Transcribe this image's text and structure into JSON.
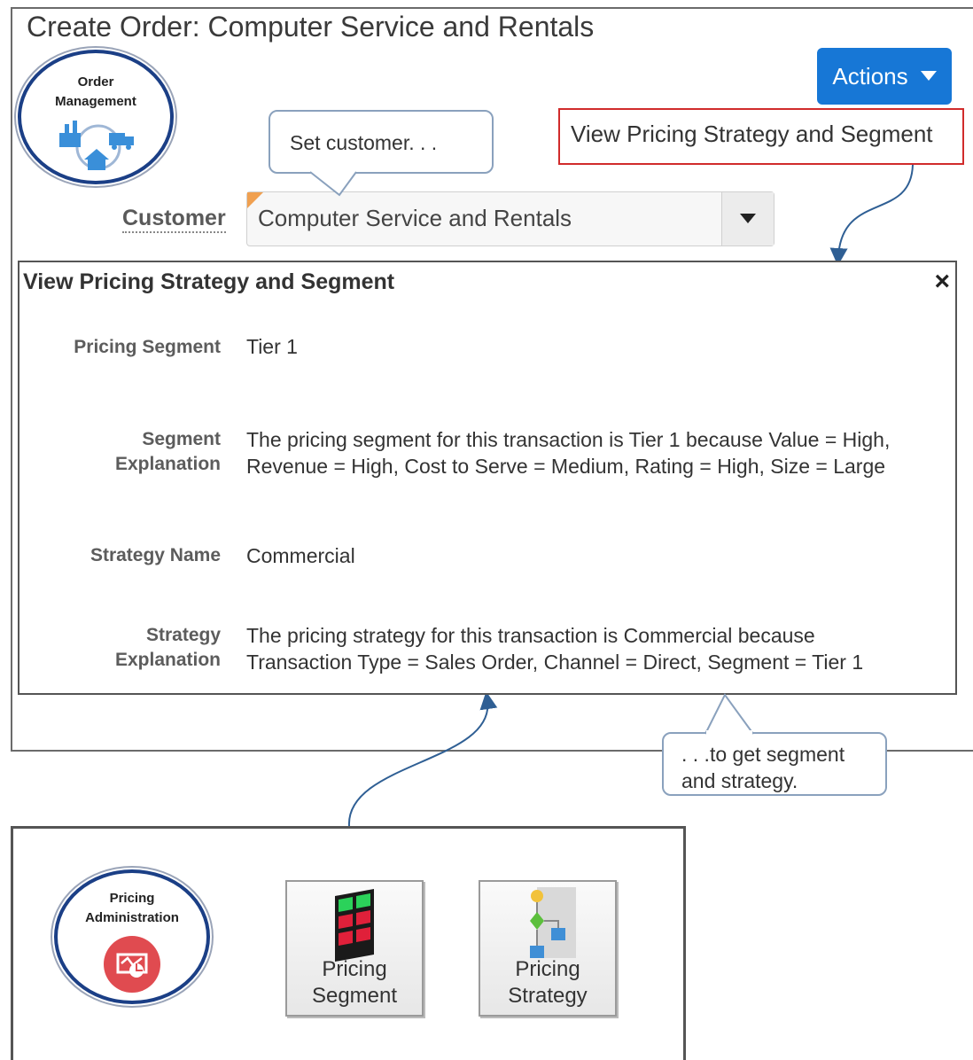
{
  "page_title": "Create Order: Computer Service and Rentals",
  "order_management_badge": {
    "line1": "Order",
    "line2": "Management"
  },
  "actions_button": {
    "label": "Actions"
  },
  "callout_set_customer": "Set customer. . .",
  "hint_box": "View Pricing Strategy and Segment",
  "customer": {
    "label": "Customer",
    "value": "Computer Service and Rentals"
  },
  "dialog": {
    "title": "View Pricing Strategy and Segment",
    "close": "×",
    "fields": {
      "pricing_segment": {
        "label": "Pricing Segment",
        "value": "Tier 1"
      },
      "segment_explanation": {
        "label_line1": "Segment",
        "label_line2": "Explanation",
        "value_line1": "The pricing segment for this transaction is Tier 1 because Value = High,",
        "value_line2": "Revenue  = High, Cost to Serve  = Medium, Rating = High, Size = Large"
      },
      "strategy_name": {
        "label": "Strategy Name",
        "value": "Commercial"
      },
      "strategy_explanation": {
        "label_line1": "Strategy",
        "label_line2": "Explanation",
        "value_line1": "The pricing strategy for this transaction is Commercial because",
        "value_line2": "Transaction Type = Sales Order, Channel = Direct, Segment = Tier 1"
      }
    }
  },
  "callout_get": {
    "line1": ". . .to get segment",
    "line2": "and strategy."
  },
  "pricing_admin_badge": {
    "line1": "Pricing",
    "line2": "Administration"
  },
  "tiles": [
    {
      "label": "Pricing\nSegment"
    },
    {
      "label": "Pricing\nStrategy"
    }
  ],
  "colors": {
    "accent": "#1777d6",
    "badge_ring": "#1b3f86",
    "hint_border": "#d12b2b",
    "callout_border": "#8aa1bd",
    "admin_icon": "#e04b50"
  }
}
